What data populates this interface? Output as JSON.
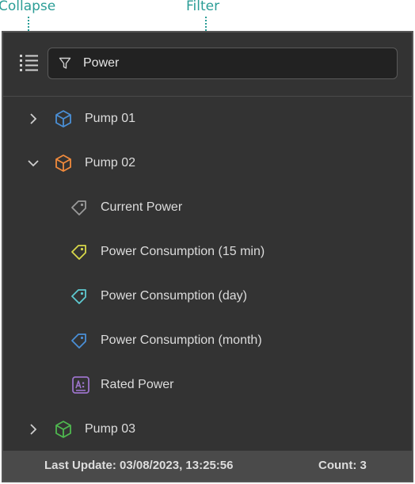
{
  "callouts": {
    "collapse": "Collapse",
    "filter": "Filter"
  },
  "toolbar": {
    "collapse_icon": "list-icon",
    "filter_icon": "funnel-icon",
    "filter_value": "Power"
  },
  "tree": {
    "pump01": {
      "label": "Pump 01",
      "expanded": false,
      "icon": "cube-icon",
      "color": "#4a8fd6"
    },
    "pump02": {
      "label": "Pump 02",
      "expanded": true,
      "icon": "cube-icon",
      "color": "#f08a3c",
      "children": [
        {
          "label": "Current Power",
          "icon": "tag-icon",
          "color": "#9a9a9a"
        },
        {
          "label": "Power Consumption (15 min)",
          "icon": "tag-icon",
          "color": "#d8d84a"
        },
        {
          "label": "Power Consumption (day)",
          "icon": "tag-icon",
          "color": "#5ec9d0"
        },
        {
          "label": "Power Consumption (month)",
          "icon": "tag-icon",
          "color": "#4a8fd6"
        },
        {
          "label": "Rated Power",
          "icon": "text-field-icon",
          "color": "#9b73c9"
        }
      ]
    },
    "pump03": {
      "label": "Pump 03",
      "expanded": false,
      "icon": "cube-icon",
      "color": "#4fb84f"
    }
  },
  "status": {
    "last_update": "Last Update: 03/08/2023, 13:25:56",
    "count": "Count: 3"
  }
}
